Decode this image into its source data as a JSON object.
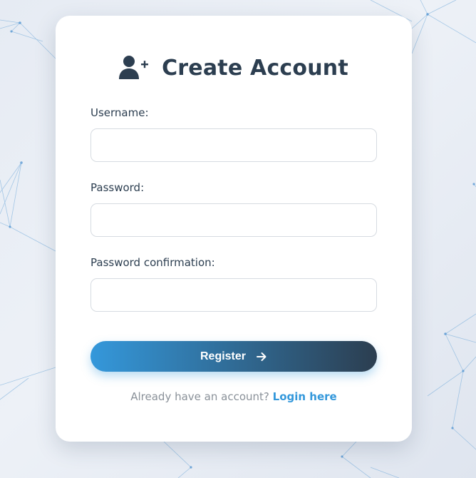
{
  "form": {
    "title": "Create Account",
    "title_icon": "user-plus-icon",
    "fields": [
      {
        "label": "Username:",
        "value": "",
        "placeholder": ""
      },
      {
        "label": "Password:",
        "value": "",
        "placeholder": ""
      },
      {
        "label": "Password confirmation:",
        "value": "",
        "placeholder": ""
      }
    ],
    "submit_label": "Register",
    "submit_icon": "arrow-right-icon",
    "footer_text": "Already have an account?",
    "footer_link": "Login here"
  },
  "colors": {
    "primary_text": "#2c3e50",
    "accent": "#3498db",
    "muted": "#8a9199",
    "button_gradient_start": "#3498db",
    "button_gradient_end": "#2c3e50"
  }
}
